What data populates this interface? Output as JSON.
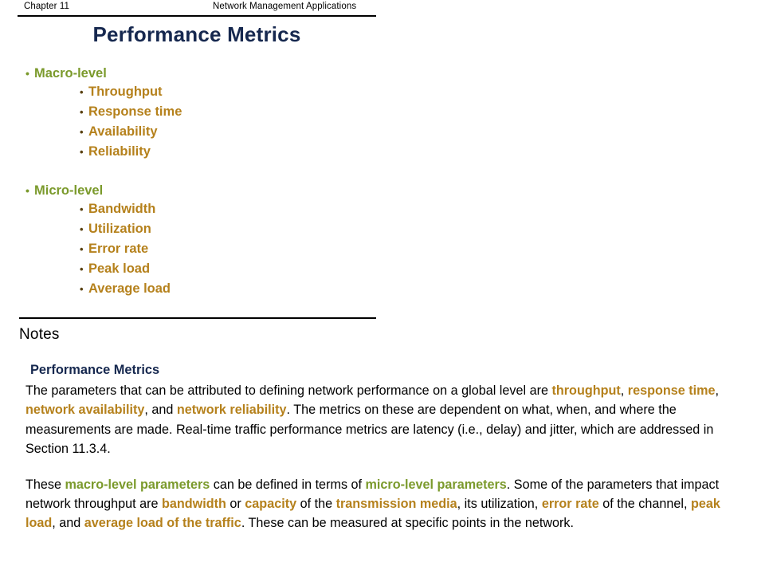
{
  "slide": {
    "header": {
      "left": "Chapter 11",
      "right": "Network Management Applications"
    },
    "title": "Performance Metrics",
    "bullet_char": "•",
    "groups": [
      {
        "label": "Macro-level",
        "color": "#7b9a2c",
        "items": [
          "Throughput",
          "Response time",
          "Availability",
          "Reliability"
        ],
        "item_color": "#b5811c"
      },
      {
        "label": "Micro-level",
        "color": "#7b9a2c",
        "items": [
          "Bandwidth",
          "Utilization",
          "Error rate",
          "Peak load",
          "Average load"
        ],
        "item_color": "#b5811c"
      }
    ]
  },
  "notes": {
    "heading": "Notes",
    "subtitle": "Performance Metrics",
    "paragraph1": {
      "t1": "The parameters that can be attributed to defining network performance on a global level are ",
      "k1": "throughput",
      "t2": ", ",
      "k2": "response time",
      "t3": ", ",
      "k3": "network availability",
      "t4": ", and ",
      "k4": "network reliability",
      "t5": ". The metrics on these are dependent on what, when, and where the measurements are made. Real-time traffic performance metrics are latency (i.e., delay) and jitter, which are addressed in Section 11.3.4."
    },
    "paragraph2": {
      "t1": "These ",
      "k1": "macro-level parameters",
      "t2": " can be defined in terms of ",
      "k2": "micro-level parameters",
      "t3": ". Some of the parameters that impact network throughput are ",
      "k3": "bandwidth",
      "t4": " or ",
      "k4": "capacity",
      "t5": " of the ",
      "k5": "transmission media",
      "t6": ", its utilization, ",
      "k6": "error rate",
      "t7": " of the channel, ",
      "k7": "peak load",
      "t8": ", and ",
      "k8": "average load of the traffic",
      "t9": ". These can be measured at specific points in the network."
    }
  },
  "colors": {
    "title_navy": "#16284f",
    "olive_green": "#7b9a2c",
    "orange_brown": "#b5811c",
    "rule_black": "#000000",
    "background": "#ffffff"
  }
}
